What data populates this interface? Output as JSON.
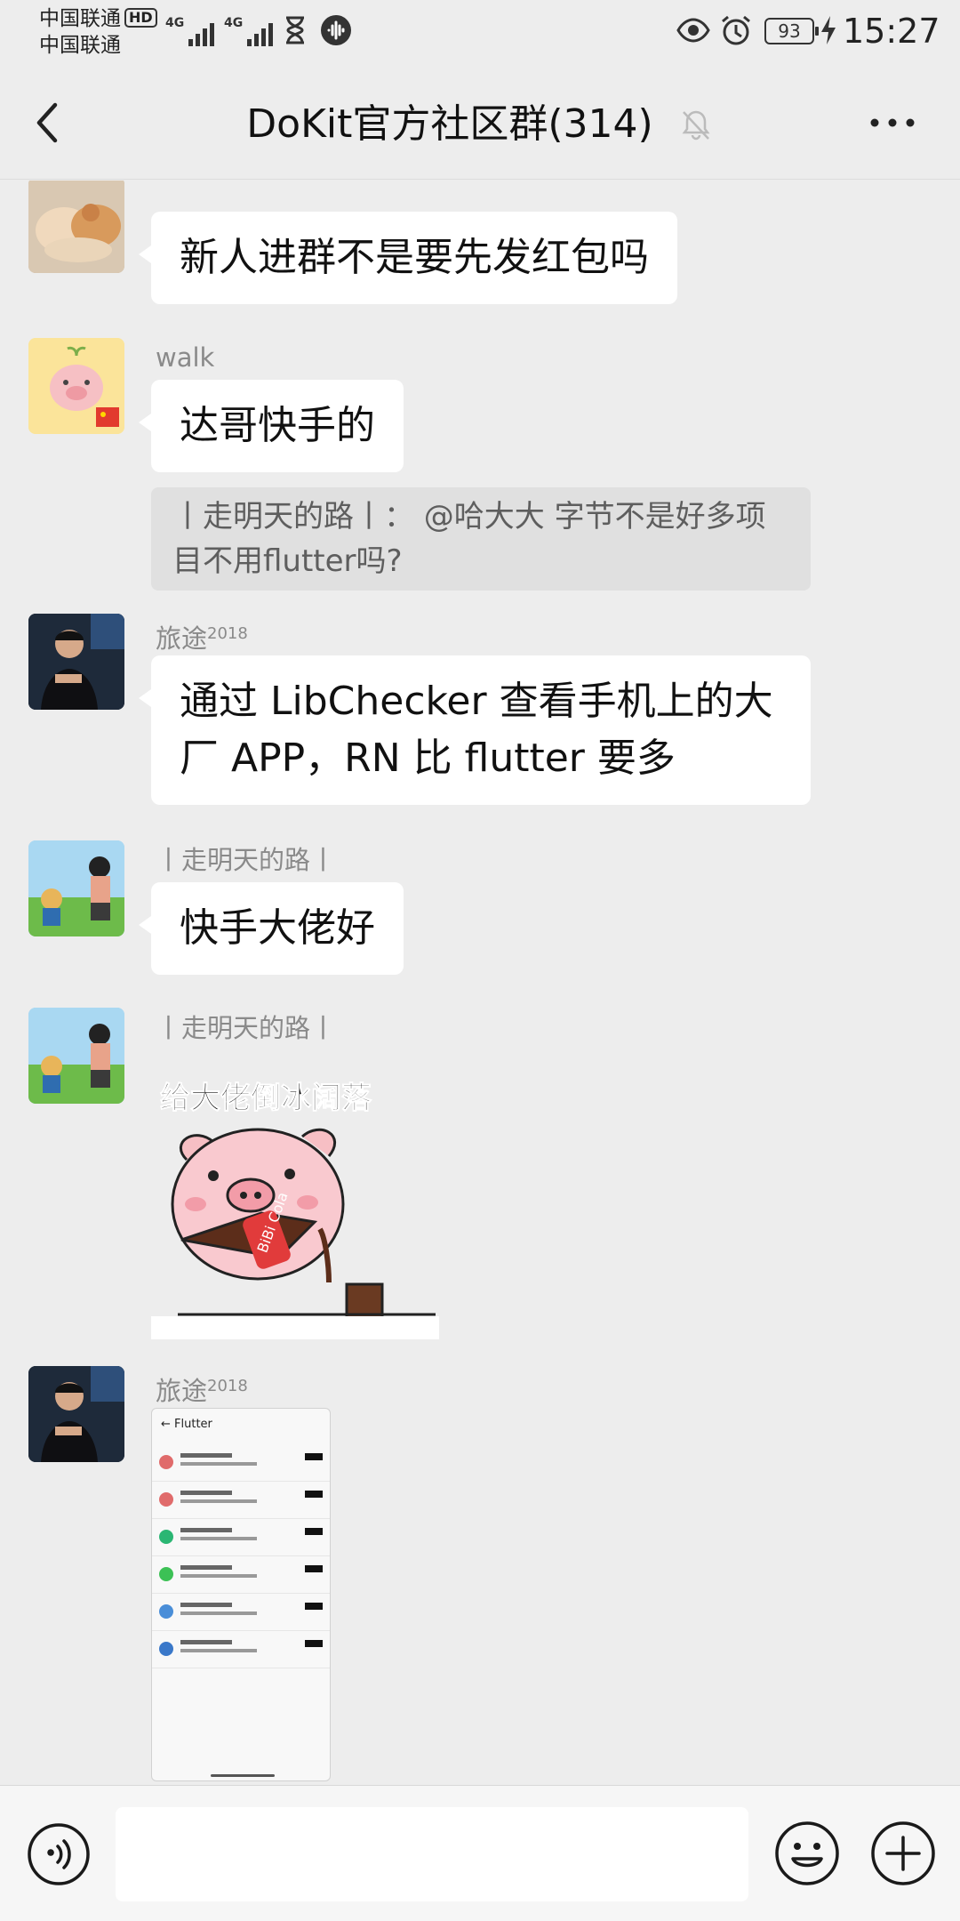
{
  "status_bar": {
    "carrier_1": "中国联通",
    "carrier_2": "中国联通",
    "hd_label": "HD",
    "network_1": "4G",
    "network_2": "4G",
    "battery": "93",
    "time": "15:27",
    "icons": [
      "hourglass-icon",
      "audio-icon",
      "eye-icon",
      "alarm-icon",
      "charging-icon"
    ]
  },
  "nav": {
    "title": "DoKit官方社区群(314)",
    "back_icon": "chevron-left-icon",
    "mute_icon": "bell-off-icon",
    "more_icon": "more-icon"
  },
  "messages": [
    {
      "sender": "",
      "type": "text",
      "text": "新人进群不是要先发红包吗"
    },
    {
      "sender": "walk",
      "type": "text",
      "text": "达哥快手的",
      "quote": "丨走明天的路丨： @哈大大 字节不是好多项目不用flutter吗?"
    },
    {
      "sender": "旅途",
      "sender_sup": "2018",
      "type": "text",
      "text": "通过 LibChecker 查看手机上的大厂 APP，RN 比 flutter 要多"
    },
    {
      "sender": "丨走明天的路丨",
      "type": "text",
      "text": "快手大佬好"
    },
    {
      "sender": "丨走明天的路丨",
      "type": "sticker",
      "sticker_caption": "给大佬倒冰阔落",
      "sticker_label": "BiBi Cola"
    },
    {
      "sender": "旅途",
      "sender_sup": "2018",
      "type": "image",
      "image_title": "Flutter"
    }
  ],
  "input_bar": {
    "voice_icon": "voice-icon",
    "emoji_icon": "emoji-icon",
    "plus_icon": "plus-icon"
  }
}
